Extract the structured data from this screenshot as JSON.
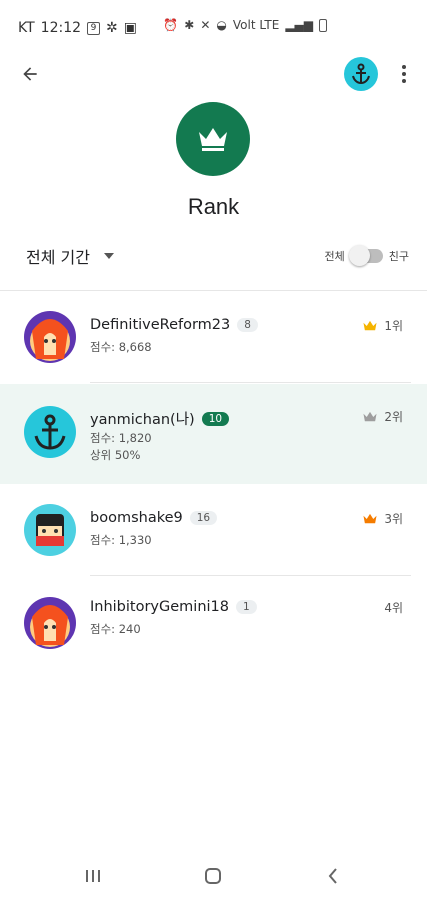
{
  "status_bar": {
    "carrier": "KT",
    "time": "12:12",
    "right_text": "Volt LTE"
  },
  "header": {
    "title": "Rank"
  },
  "filters": {
    "period_label": "전체 기간",
    "scope_all_label": "전체",
    "scope_friends_label": "친구",
    "scope_friends_only": false
  },
  "ranking": [
    {
      "name": "DefinitiveReform23",
      "level": "8",
      "score": "점수: 8,668",
      "percentile": "",
      "rank": "1위",
      "crown": "gold-crown-icon",
      "crown_color": "#f5b400",
      "is_me": false
    },
    {
      "name": "yanmichan(나)",
      "level": "10",
      "score": "점수: 1,820",
      "percentile": "상위 50%",
      "rank": "2위",
      "crown": "silver-crown-icon",
      "crown_color": "#9e9e9e",
      "is_me": true
    },
    {
      "name": "boomshake9",
      "level": "16",
      "score": "점수: 1,330",
      "percentile": "",
      "rank": "3위",
      "crown": "bronze-crown-icon",
      "crown_color": "#f57c00",
      "is_me": false
    },
    {
      "name": "InhibitoryGemini18",
      "level": "1",
      "score": "점수: 240",
      "percentile": "",
      "rank": "4위",
      "crown": "",
      "crown_color": "",
      "is_me": false
    }
  ],
  "colors": {
    "accent": "#137a50",
    "highlight_row": "#eef6f3"
  }
}
